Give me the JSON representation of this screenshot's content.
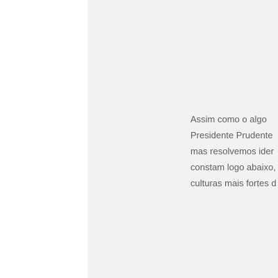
{
  "document": {
    "paragraph_lines": [
      "Assim como o algo",
      "Presidente Prudente",
      "mas resolvemos ider",
      "constam logo abaixo,",
      "culturas mais fortes d"
    ]
  }
}
